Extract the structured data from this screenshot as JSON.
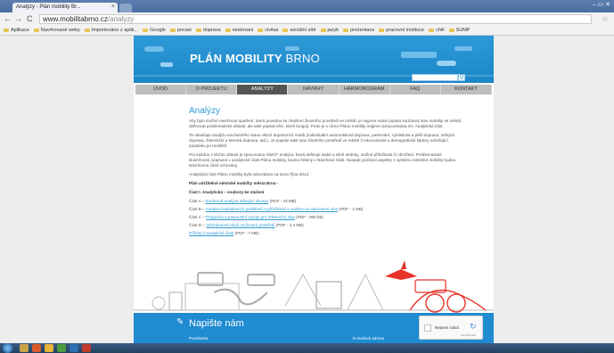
{
  "browser": {
    "tab_title": "Analýzy - Plán mobility Br...",
    "tab_close": "×",
    "window_controls": "– ▭ ✕",
    "nav": {
      "back": "←",
      "forward": "→",
      "reload": "C"
    },
    "url_host": "www.mobilitabrno.cz",
    "url_path": "/analyzy",
    "bookmarks": [
      "Aplikace",
      "Navrhované weby",
      "Importováno z aplik...",
      "Google",
      "pocasi",
      "doprava",
      "nestovani",
      "civitas",
      "sociální sítě",
      "jazyk",
      "prezentace",
      "pracovní instituce",
      "chill",
      "SUMP"
    ]
  },
  "site": {
    "logo_bold": "PLÁN MOBILITY",
    "logo_light": " BRNO",
    "search_button": "Q",
    "menu": [
      "ÚVOD",
      "O PROJEKTU",
      "ANALÝZY",
      "NÁVRHY",
      "HARMONOGRAM",
      "FAQ",
      "KONTAKT"
    ],
    "active_menu_index": 2,
    "content": {
      "heading": "Analýzy",
      "paragraphs": [
        "Aby bylo možné navrhnout opatření, která povedou ke zlepšení životního prostředí ve městě, je nejprve nutné popsat současný stav mobility ve městě, definovat problematické oblasti, ale také popsat věci, které fungují. Proto je v rámci Plánu mobility nejprve zpracovávána tzv. Analytická část.",
        "Ta obsahuje analýzu současného stavu všech dopravních módů (individuální automobilová doprava, parkování, cyklistická a pěší doprava, veřejná doprava, železniční a letecká doprava, atd.). Je popsán také stav životního prostředí ve městě či ekonomické a demografické faktory ovlivňující poptávku po mobilitě.",
        "Pro každou z těchto oblastí je zpracována SWOT analýza, která definuje slabé a silné stránky, možné příležitosti či ohrožení. Problematické skutečnosti, popsané v analytické části Plánu mobility, budou řešeny v Návrhové části. Naopak pozitivní aspekty z systému městské mobility budou Návrhovou částí uchovány.",
        "Analytická část Plánu mobility byla odevzdána na konci října 2014."
      ],
      "plan_title": "Plán udržitelné městské mobility města Brna -",
      "part_title": "Část I. Analytická – soubory ke stažení",
      "parts": [
        {
          "prefix": "Část A – ",
          "link": "Souhrnná analýza stávající situace",
          "suffix": " (PDF - 23 MB)"
        },
        {
          "prefix": "Část B – ",
          "link": "Analýza kvalitativních problémů a příležitostí s vazbou na stanovené vize",
          "suffix": " (PDF - 1 MB)"
        },
        {
          "prefix": "Část C – ",
          "link": "Prognóza a posouzení vývoje pro referenční stav",
          "suffix": " (PDF - 900 kB)"
        },
        {
          "prefix": "Část D – ",
          "link": "Vyhodnocení vlivů na životní prostředí",
          "suffix": " (PDF - 2,3 MB)"
        },
        {
          "prefix": "",
          "link": "Přílohy k analytické části",
          "suffix": " (PDF - 7 MB)"
        }
      ]
    },
    "contact": {
      "title": "Napište nám",
      "label_left": "Poznámka",
      "label_right": "E-mailová adresa",
      "captcha_text": "Nejsem robot",
      "captcha_sub": "reCAPTCHA"
    }
  },
  "taskbar": {
    "tray_text": ""
  },
  "colors": {
    "brand_blue": "#2d9ad8",
    "menu_gray": "#bdbdbd",
    "menu_active": "#555555",
    "accent_red": "#e8332a"
  }
}
